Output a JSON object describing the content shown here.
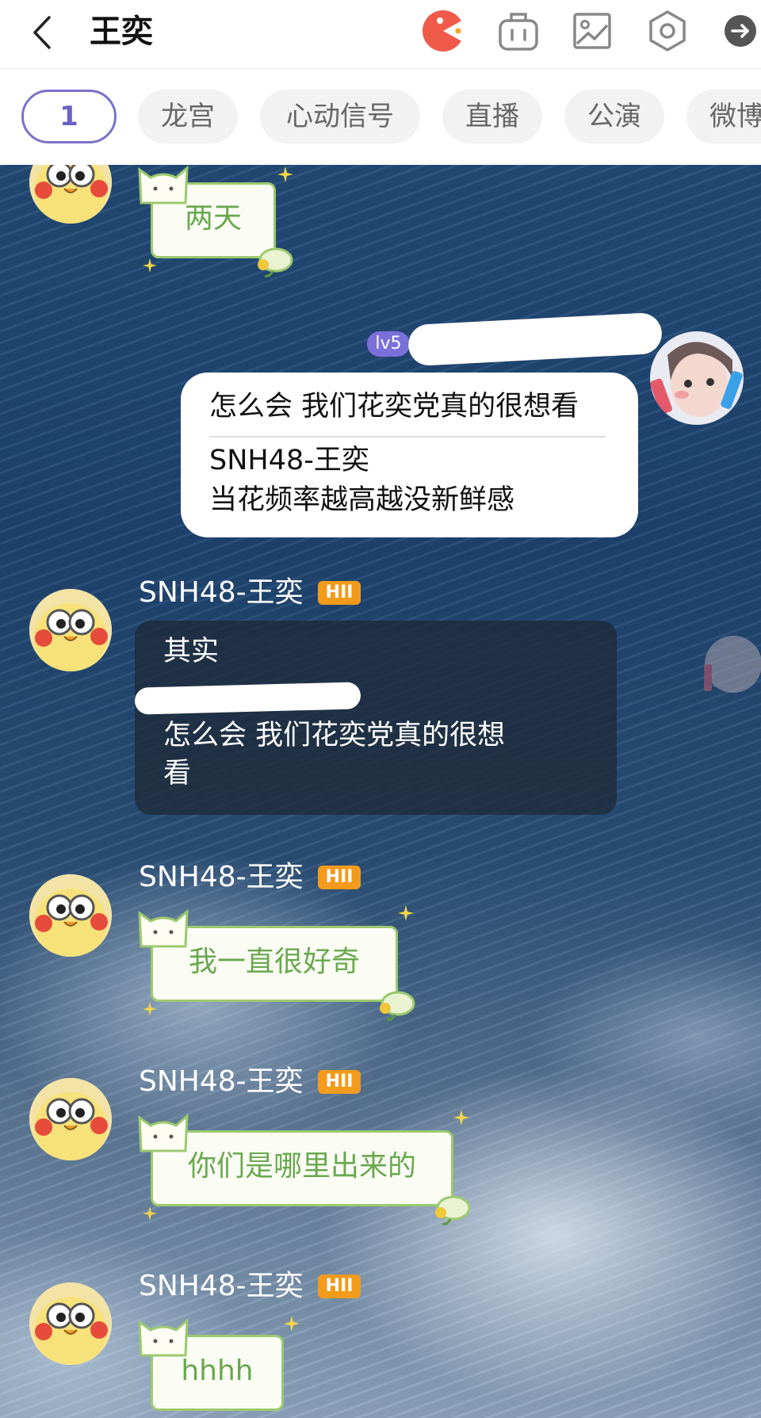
{
  "header": {
    "title": "王奕",
    "icons": [
      "back-icon",
      "game-pacman-icon",
      "gift-bag-icon",
      "gallery-image-icon",
      "settings-hexagon-icon",
      "share-arrow-icon"
    ]
  },
  "tabs": [
    {
      "label": "1",
      "active": true
    },
    {
      "label": "龙宫"
    },
    {
      "label": "心动信号"
    },
    {
      "label": "直播"
    },
    {
      "label": "公演"
    },
    {
      "label": "微博"
    }
  ],
  "messages": [
    {
      "type": "sticker",
      "text": "两天"
    },
    {
      "type": "reply",
      "level": "lv5",
      "quote": "怎么会  我们花奕党真的很想看",
      "quote_author": "SNH48-王奕",
      "text": "当花频率越高越没新鲜感"
    },
    {
      "type": "dark-reply",
      "username": "SNH48-王奕",
      "badge": "HII",
      "lines": [
        "其实",
        "怎么会  我们花奕党真的很想",
        "看"
      ]
    },
    {
      "type": "sticker",
      "username": "SNH48-王奕",
      "badge": "HII",
      "text": "我一直很好奇"
    },
    {
      "type": "sticker",
      "username": "SNH48-王奕",
      "badge": "HII",
      "text": "你们是哪里出来的"
    },
    {
      "type": "sticker",
      "username": "SNH48-王奕",
      "badge": "HII",
      "text": "hhhh"
    }
  ],
  "colors": {
    "accent": "#7a72c9",
    "sticker_text": "#6aa84f",
    "level_badge": "#f39b1a",
    "lv_badge": "#7b6fd9"
  }
}
